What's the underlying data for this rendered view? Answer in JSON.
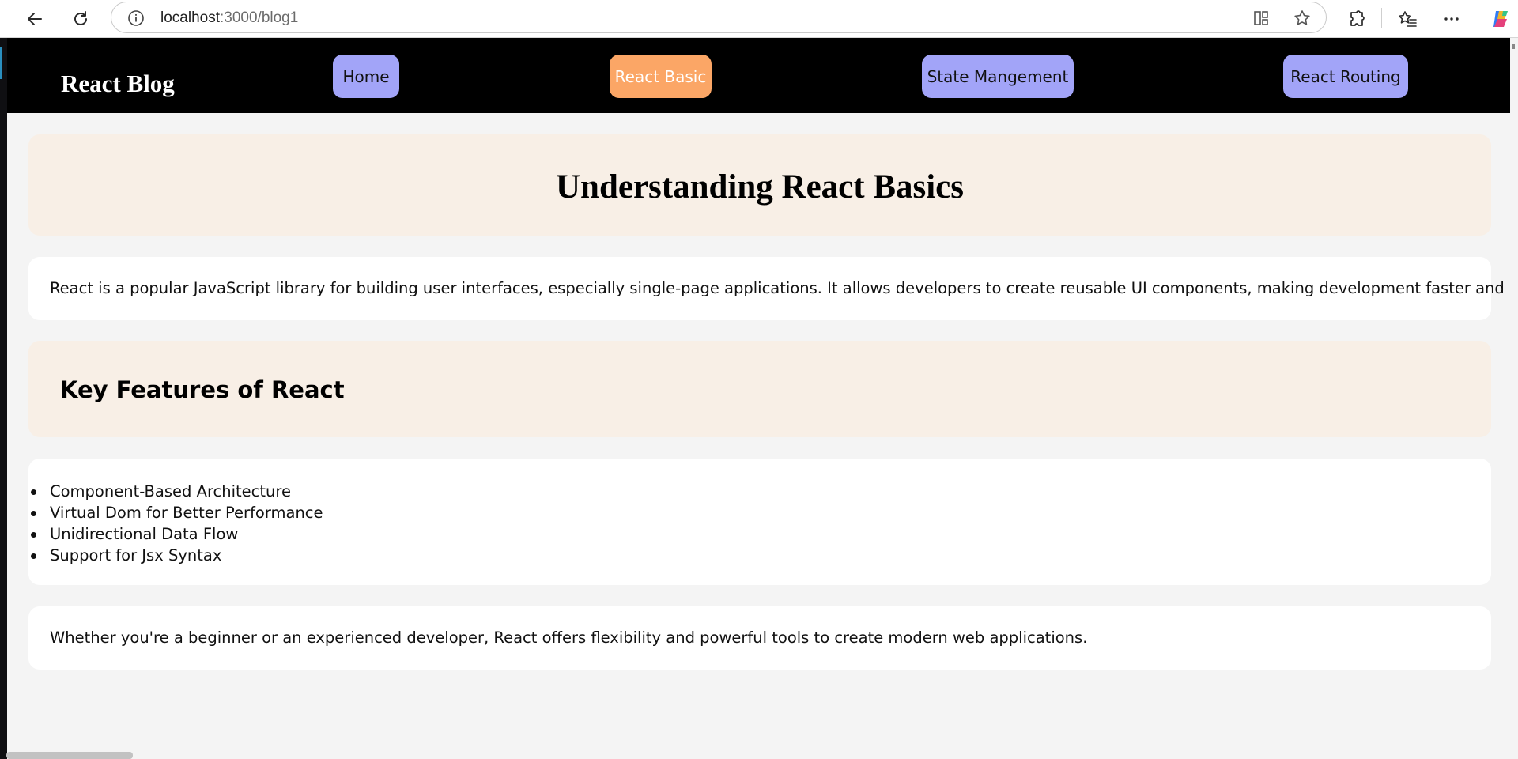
{
  "browser": {
    "url_host": "localhost",
    "url_rest": ":3000/blog1",
    "icons": {
      "back": "back-arrow-icon",
      "reload": "reload-icon",
      "info": "info-icon",
      "split": "split-screen-icon",
      "favorite": "star-icon",
      "extensions": "puzzle-icon",
      "favorites_bar": "favorites-icon",
      "menu": "more-icon",
      "copilot": "copilot-icon"
    }
  },
  "navbar": {
    "brand": "React Blog",
    "items": [
      {
        "label": "Home",
        "active": false
      },
      {
        "label": "React Basic",
        "active": true
      },
      {
        "label": "State Mangement",
        "active": false
      },
      {
        "label": "React Routing",
        "active": false
      }
    ],
    "colors": {
      "background": "#000000",
      "button": "#a2a4f8",
      "active": "#fba666"
    }
  },
  "article": {
    "title": "Understanding React Basics",
    "intro": "React is a popular JavaScript library for building user interfaces, especially single-page applications. It allows developers to create reusable UI components, making development faster and easier.",
    "features_heading": "Key Features of React",
    "features": [
      "Component-Based Architecture",
      "Virtual Dom for Better Performance",
      "Unidirectional Data Flow",
      "Support for Jsx Syntax"
    ],
    "closing": "Whether you're a beginner or an experienced developer, React offers flexibility and powerful tools to create modern web applications.",
    "colors": {
      "tint_card": "#f8efe6",
      "page_background": "#f4f4f4"
    }
  }
}
